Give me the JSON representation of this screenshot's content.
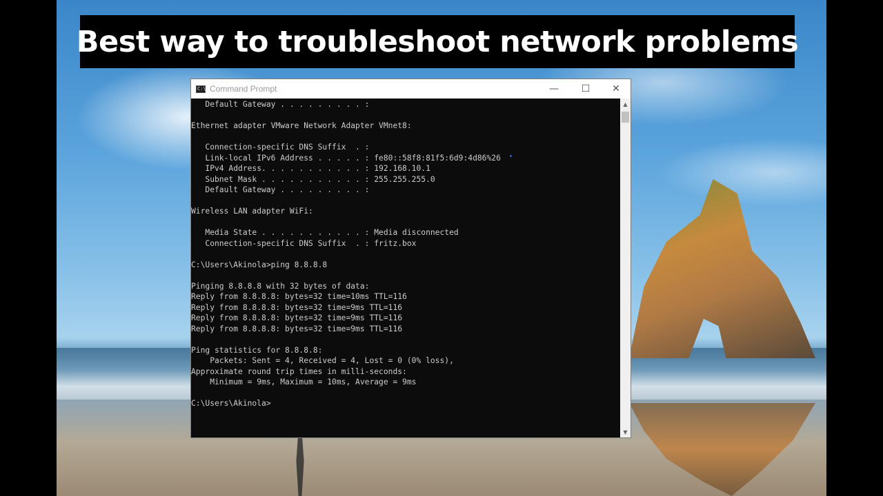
{
  "banner": {
    "title": "Best way to troubleshoot network problems"
  },
  "window": {
    "title": "Command Prompt",
    "icon": "cmd-icon",
    "controls": {
      "minimize": "—",
      "maximize": "☐",
      "close": "✕"
    }
  },
  "console": {
    "lines": [
      "   Default Gateway . . . . . . . . . :",
      "",
      "Ethernet adapter VMware Network Adapter VMnet8:",
      "",
      "   Connection-specific DNS Suffix  . :",
      "   Link-local IPv6 Address . . . . . : fe80::58f8:81f5:6d9:4d86%26",
      "   IPv4 Address. . . . . . . . . . . : 192.168.10.1",
      "   Subnet Mask . . . . . . . . . . . : 255.255.255.0",
      "   Default Gateway . . . . . . . . . :",
      "",
      "Wireless LAN adapter WiFi:",
      "",
      "   Media State . . . . . . . . . . . : Media disconnected",
      "   Connection-specific DNS Suffix  . : fritz.box",
      "",
      "C:\\Users\\Akinola>ping 8.8.8.8",
      "",
      "Pinging 8.8.8.8 with 32 bytes of data:",
      "Reply from 8.8.8.8: bytes=32 time=10ms TTL=116",
      "Reply from 8.8.8.8: bytes=32 time=9ms TTL=116",
      "Reply from 8.8.8.8: bytes=32 time=9ms TTL=116",
      "Reply from 8.8.8.8: bytes=32 time=9ms TTL=116",
      "",
      "Ping statistics for 8.8.8.8:",
      "    Packets: Sent = 4, Received = 4, Lost = 0 (0% loss),",
      "Approximate round trip times in milli-seconds:",
      "    Minimum = 9ms, Maximum = 10ms, Average = 9ms",
      "",
      "C:\\Users\\Akinola>"
    ]
  },
  "scrollbar": {
    "up_icon": "chevron-up-icon",
    "down_icon": "chevron-down-icon",
    "up_glyph": "▲",
    "down_glyph": "▼"
  },
  "colors": {
    "console_bg": "#0c0c0c",
    "console_text": "#cccccc",
    "banner_bg": "#000000",
    "banner_text": "#ffffff"
  }
}
